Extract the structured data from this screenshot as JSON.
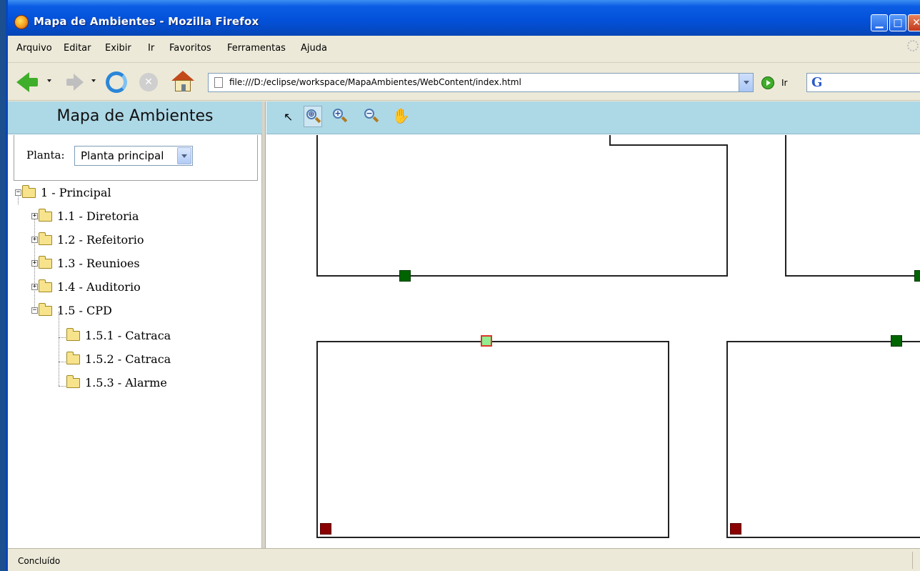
{
  "window": {
    "title": "Mapa de Ambientes - Mozilla Firefox"
  },
  "menubar": {
    "items": [
      "Arquivo",
      "Editar",
      "Exibir",
      "Ir",
      "Favoritos",
      "Ferramentas",
      "Ajuda"
    ]
  },
  "navbar": {
    "url": "file:///D:/eclipse/workspace/MapaAmbientes/WebContent/index.html",
    "go_label": "Ir"
  },
  "sidebar": {
    "title": "Mapa de Ambientes",
    "planta_label": "Planta:",
    "planta_selected": "Planta principal",
    "tree": [
      {
        "label": "1 - Principal",
        "expanded": true
      },
      {
        "label": "1.1 - Diretoria",
        "expanded": false
      },
      {
        "label": "1.2 - Refeitorio",
        "expanded": false
      },
      {
        "label": "1.3 - Reunioes",
        "expanded": false
      },
      {
        "label": "1.4 - Auditorio",
        "expanded": false
      },
      {
        "label": "1.5 - CPD",
        "expanded": true
      },
      {
        "label": "1.5.1 - Catraca"
      },
      {
        "label": "1.5.2 - Catraca"
      },
      {
        "label": "1.5.3 - Alarme"
      }
    ]
  },
  "map": {
    "tools": [
      "pointer-icon",
      "zoom-rect-icon",
      "zoom-in-icon",
      "zoom-out-icon",
      "pan-hand-icon"
    ],
    "active_tool": "zoom-rect-icon",
    "device_colors": {
      "ok": "#006400",
      "alarm": "#8b0000",
      "selected": "#90ee90",
      "selected_border": "#e0342a"
    }
  },
  "statusbar": {
    "text": "Concluído"
  },
  "colors": {
    "panel_header": "#add8e6",
    "titlebar": "#0350d8"
  }
}
